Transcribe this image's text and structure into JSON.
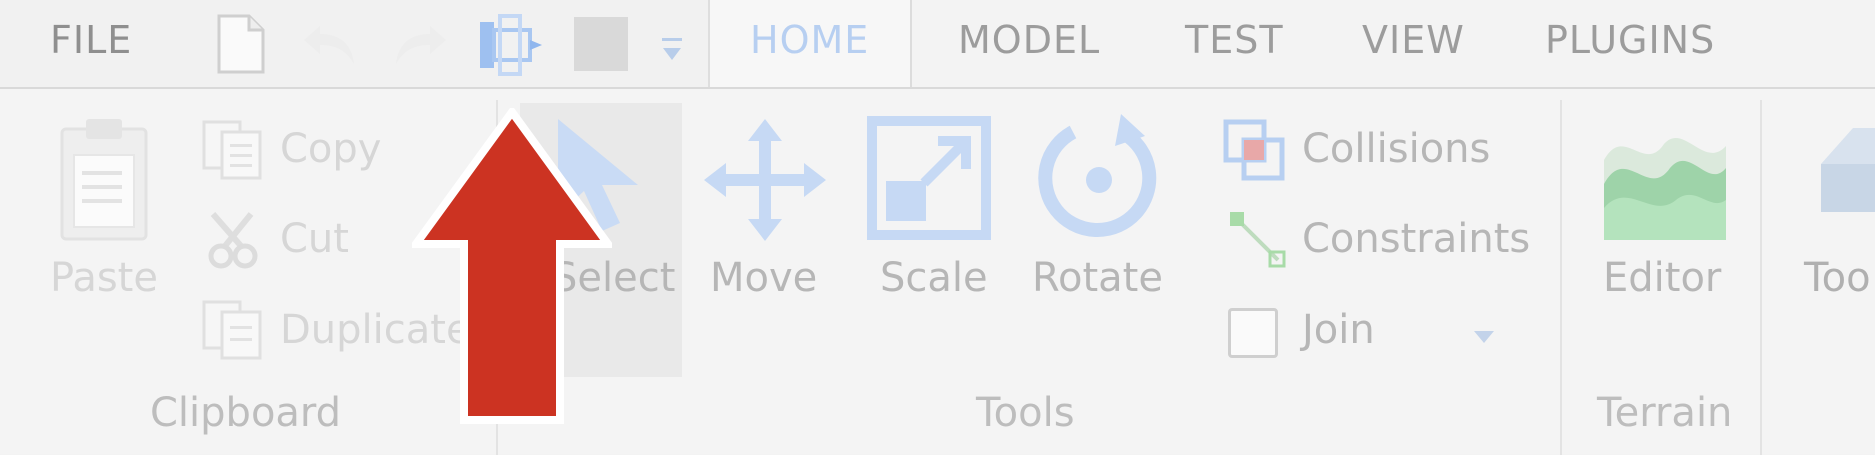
{
  "tabs": {
    "file": "FILE",
    "home": "HOME",
    "model": "MODEL",
    "test": "TEST",
    "view": "VIEW",
    "plugins": "PLUGINS"
  },
  "quick_access": {
    "icons": [
      "new-document-icon",
      "undo-icon",
      "redo-icon",
      "publish-place-icon",
      "stop-icon",
      "customize-dropdown-icon"
    ]
  },
  "clipboard": {
    "paste": "Paste",
    "copy": "Copy",
    "cut": "Cut",
    "duplicate": "Duplicate",
    "title": "Clipboard"
  },
  "tools": {
    "select": "Select",
    "move": "Move",
    "scale": "Scale",
    "rotate": "Rotate",
    "collisions": "Collisions",
    "constraints": "Constraints",
    "join": "Join",
    "title": "Tools"
  },
  "terrain": {
    "editor": "Editor",
    "title": "Terrain"
  },
  "toolbox": {
    "label": "Too"
  },
  "colors": {
    "accent": "#b7cff1",
    "arrow": "#cc3322",
    "tab_text": "#9c9c9c"
  }
}
